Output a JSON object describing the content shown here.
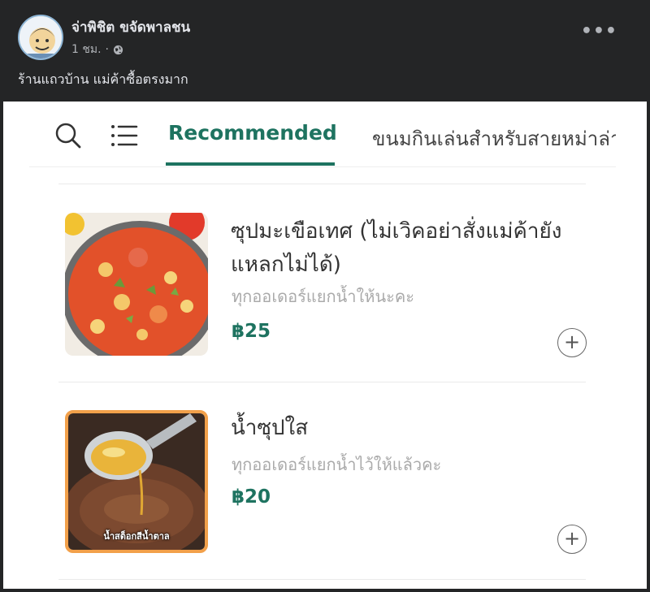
{
  "post": {
    "author": "จ่าพิชิต ขจัดพาลชน",
    "time": "1 ชม.",
    "separator": "·",
    "more_label": "•••",
    "caption": "ร้านแถวบ้าน แม่ค้าซื้อตรงมาก"
  },
  "app": {
    "tabs": [
      {
        "label": "Recommended",
        "active": true
      },
      {
        "label": "ขนมกินเล่นสำหรับสายหม่าล่า",
        "active": false
      }
    ],
    "accent_color": "#1e7360",
    "items": [
      {
        "title": "ซุปมะเขือเทศ (ไม่เวิคอย่าสั่งแม่ค้ายังแหลกไม่ได้)",
        "description": "ทุกออเดอร์แยกน้ำให้นะคะ",
        "price": "฿25",
        "image_icon": "tomato-soup-photo",
        "add_label": "+"
      },
      {
        "title": "น้ำซุปใส",
        "description": "ทุกออเดอร์แยกน้ำไว้ให้แล้วคะ",
        "price": "฿20",
        "image_icon": "clear-broth-photo",
        "image_caption": "น้ำสต็อกสีน้ำตาล",
        "add_label": "+"
      }
    ]
  }
}
